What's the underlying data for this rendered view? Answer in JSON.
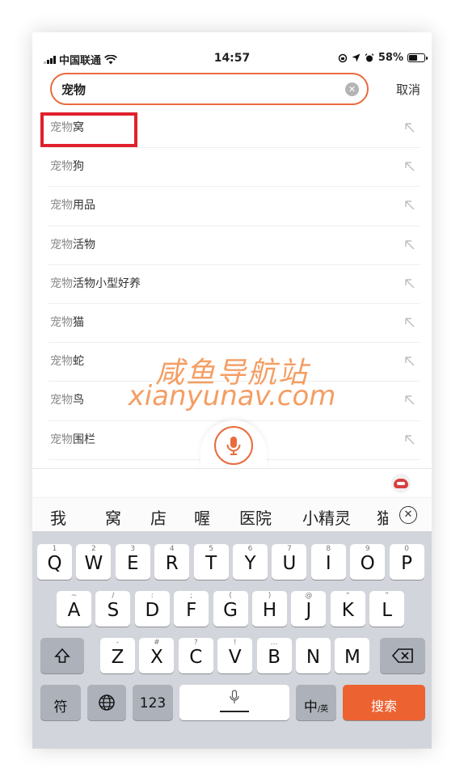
{
  "status": {
    "carrier": "中国联通",
    "time": "14:57",
    "battery": "58%",
    "battery_level": 0.58
  },
  "search": {
    "query": "宠物",
    "cancel_label": "取消"
  },
  "suggestions": [
    {
      "prefix": "宠物",
      "rest": "窝"
    },
    {
      "prefix": "宠物",
      "rest": "狗"
    },
    {
      "prefix": "宠物",
      "rest": "用品"
    },
    {
      "prefix": "宠物",
      "rest": "活物"
    },
    {
      "prefix": "宠物",
      "rest": "活物小型好养"
    },
    {
      "prefix": "宠物",
      "rest": "猫"
    },
    {
      "prefix": "宠物",
      "rest": "蛇"
    },
    {
      "prefix": "宠物",
      "rest": "鸟"
    },
    {
      "prefix": "宠物",
      "rest": "围栏"
    }
  ],
  "watermark": {
    "line1": "咸鱼导航站",
    "line2": "xianyunav.com"
  },
  "candidates": [
    "我",
    "窝",
    "店",
    "喔",
    "医院",
    "小精灵",
    "猫"
  ],
  "keyboard": {
    "row1": [
      {
        "main": "Q",
        "sub": "1"
      },
      {
        "main": "W",
        "sub": "2"
      },
      {
        "main": "E",
        "sub": "3"
      },
      {
        "main": "R",
        "sub": "4"
      },
      {
        "main": "T",
        "sub": "5"
      },
      {
        "main": "Y",
        "sub": "6"
      },
      {
        "main": "U",
        "sub": "7"
      },
      {
        "main": "I",
        "sub": "8"
      },
      {
        "main": "O",
        "sub": "9"
      },
      {
        "main": "P",
        "sub": "0"
      }
    ],
    "row2": [
      {
        "main": "A",
        "sub": "~"
      },
      {
        "main": "S",
        "sub": "/"
      },
      {
        "main": "D",
        "sub": ":"
      },
      {
        "main": "F",
        "sub": ";"
      },
      {
        "main": "G",
        "sub": "("
      },
      {
        "main": "H",
        "sub": ")"
      },
      {
        "main": "J",
        "sub": "@"
      },
      {
        "main": "K",
        "sub": "“"
      },
      {
        "main": "L",
        "sub": "”"
      }
    ],
    "row3": [
      {
        "main": "Z",
        "sub": "-"
      },
      {
        "main": "X",
        "sub": "#"
      },
      {
        "main": "C",
        "sub": "?"
      },
      {
        "main": "V",
        "sub": "!"
      },
      {
        "main": "B",
        "sub": "…"
      },
      {
        "main": "N",
        "sub": ""
      },
      {
        "main": "M",
        "sub": ""
      }
    ],
    "symbols_label": "符",
    "numbers_label": "123",
    "lang_label": "中",
    "lang_sub": "/英",
    "search_label": "搜索"
  },
  "colors": {
    "accent": "#e96b3d",
    "highlight_box": "#e0212c",
    "search_key": "#ec6230"
  }
}
